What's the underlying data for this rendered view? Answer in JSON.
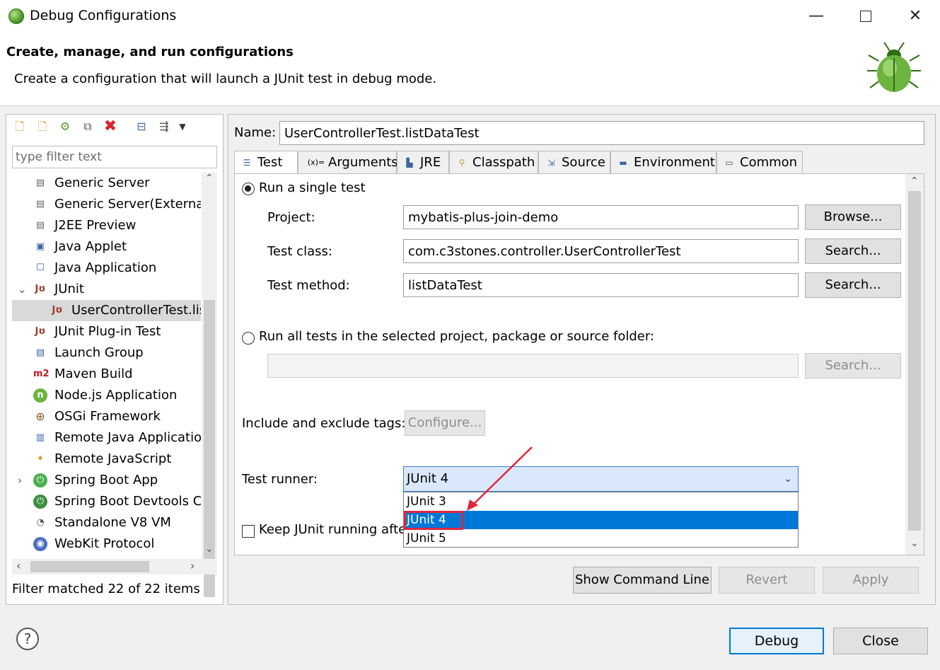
{
  "window": {
    "title": "Debug Configurations",
    "min_glyph": "—",
    "close_glyph": "✕"
  },
  "header": {
    "title": "Create, manage, and run configurations",
    "description": "Create a configuration that will launch a JUnit test in debug mode."
  },
  "left": {
    "toolbar_icons": [
      "new-configuration-icon",
      "new-prototype-icon",
      "export-icon",
      "duplicate-icon",
      "delete-icon",
      "collapse-all-icon",
      "filter-icon",
      "view-menu-icon"
    ],
    "filter_placeholder": "type filter text",
    "tree": [
      {
        "label": "Generic Server",
        "icon": "server-icon"
      },
      {
        "label": "Generic Server(External",
        "icon": "server-icon"
      },
      {
        "label": "J2EE Preview",
        "icon": "server-icon"
      },
      {
        "label": "Java Applet",
        "icon": "applet-icon"
      },
      {
        "label": "Java Application",
        "icon": "java-app-icon"
      },
      {
        "label": "JUnit",
        "icon": "junit-icon",
        "expanded": true
      },
      {
        "label": "UserControllerTest.lis",
        "icon": "junit-icon",
        "child": true,
        "selected": true
      },
      {
        "label": "JUnit Plug-in Test",
        "icon": "junit-plugin-icon"
      },
      {
        "label": "Launch Group",
        "icon": "launch-group-icon"
      },
      {
        "label": "Maven Build",
        "icon": "maven-icon"
      },
      {
        "label": "Node.js Application",
        "icon": "nodejs-icon"
      },
      {
        "label": "OSGi Framework",
        "icon": "osgi-icon"
      },
      {
        "label": "Remote Java Applicatio",
        "icon": "remote-java-icon"
      },
      {
        "label": "Remote JavaScript",
        "icon": "remote-js-icon"
      },
      {
        "label": "Spring Boot App",
        "icon": "spring-boot-icon",
        "collapsed": true
      },
      {
        "label": "Spring Boot Devtools C",
        "icon": "spring-devtools-icon"
      },
      {
        "label": "Standalone V8 VM",
        "icon": "v8-icon"
      },
      {
        "label": "WebKit Protocol",
        "icon": "webkit-icon"
      }
    ],
    "tree_glyphs": {
      "junit": "Jʊ",
      "maven": "m2",
      "nodejs": "n",
      "osgi": "⊕",
      "spring": "⏻"
    },
    "scroll": {
      "up": "⌃",
      "down": "⌄",
      "left": "‹",
      "right": "›"
    },
    "filter_status": "Filter matched 22 of 22 items"
  },
  "right": {
    "name_label": "Name:",
    "name_value": "UserControllerTest.listDataTest",
    "tabs": [
      {
        "label": "Test",
        "icon": "test-icon",
        "active": true
      },
      {
        "label": "Arguments",
        "icon": "arguments-icon"
      },
      {
        "label": "JRE",
        "icon": "jre-icon"
      },
      {
        "label": "Classpath",
        "icon": "classpath-icon"
      },
      {
        "label": "Source",
        "icon": "source-icon"
      },
      {
        "label": "Environment",
        "icon": "environment-icon"
      },
      {
        "label": "Common",
        "icon": "common-icon"
      }
    ],
    "tab_glyphs": {
      "arguments": "(x)="
    },
    "run_single_label": "Run a single test",
    "project_label": "Project:",
    "project_value": "mybatis-plus-join-demo",
    "browse_label": "Browse...",
    "test_class_label": "Test class:",
    "test_class_value": "com.c3stones.controller.UserControllerTest",
    "search_label": "Search...",
    "test_method_label": "Test method:",
    "test_method_value": "listDataTest",
    "run_all_label": "Run all tests in the selected project, package or source folder:",
    "tags_label": "Include and exclude tags:",
    "configure_label": "Configure...",
    "runner_label": "Test runner:",
    "runner_value": "JUnit 4",
    "runner_chevron": "⌄",
    "runner_options": [
      "JUnit 3",
      "JUnit 4",
      "JUnit 5"
    ],
    "keep_running_label": "Keep JUnit running afte",
    "show_command_line": "Show Command Line",
    "revert": "Revert",
    "apply": "Apply"
  },
  "footer": {
    "help": "?",
    "debug": "Debug",
    "close": "Close"
  }
}
